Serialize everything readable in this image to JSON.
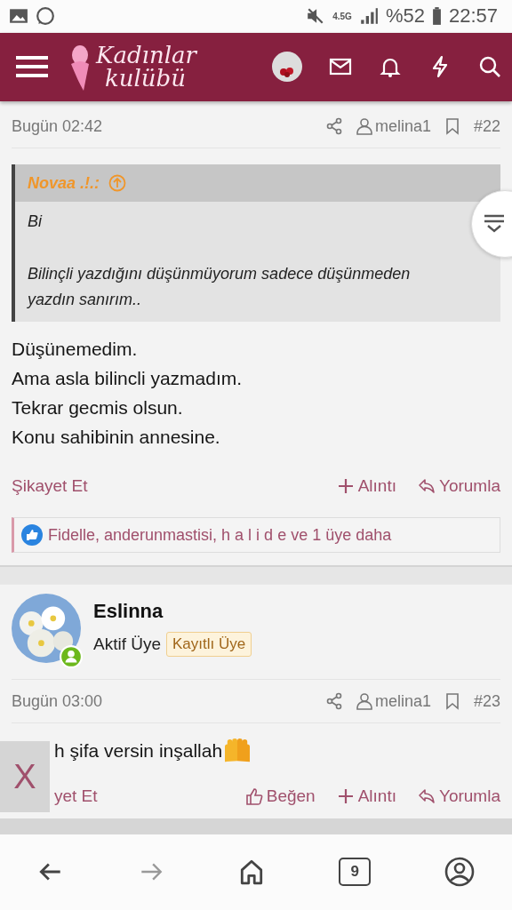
{
  "status_bar": {
    "battery": "%52",
    "time": "22:57",
    "network": "4.5G"
  },
  "header": {
    "logo_line1": "Kadınlar",
    "logo_line2": "kulübü"
  },
  "posts": [
    {
      "time": "Bugün 02:42",
      "user": "melina1",
      "number": "#22",
      "quote": {
        "author": "Novaa .!.:",
        "lines": [
          "Bi",
          "Bilinçli yazdığını düşünmüyorum sadece düşünmeden yazdın sanırım.."
        ]
      },
      "body": [
        "Düşünemedim.",
        "Ama asla bilincli yazmadım.",
        "Tekrar gecmis olsun.",
        "Konu sahibinin annesine."
      ],
      "report": "Şikayet Et",
      "actions": [
        {
          "kind": "quote",
          "label": "Alıntı"
        },
        {
          "kind": "reply",
          "label": "Yorumla"
        }
      ],
      "likes": "Fidelle, anderunmastisi, h a l i d e ve 1 üye daha"
    },
    {
      "author": {
        "name": "Eslinna",
        "title": "Aktif Üye",
        "badge": "Kayıtlı Üye",
        "online": true
      },
      "time": "Bugün 03:00",
      "user": "melina1",
      "number": "#23",
      "body": [
        "h şifa versin inşallah"
      ],
      "report": "yet Et",
      "actions": [
        {
          "kind": "like",
          "label": "Beğen"
        },
        {
          "kind": "quote",
          "label": "Alıntı"
        },
        {
          "kind": "reply",
          "label": "Yorumla"
        }
      ]
    }
  ],
  "overlay_close": "X",
  "bottom_nav": {
    "tabs_count": "9"
  }
}
